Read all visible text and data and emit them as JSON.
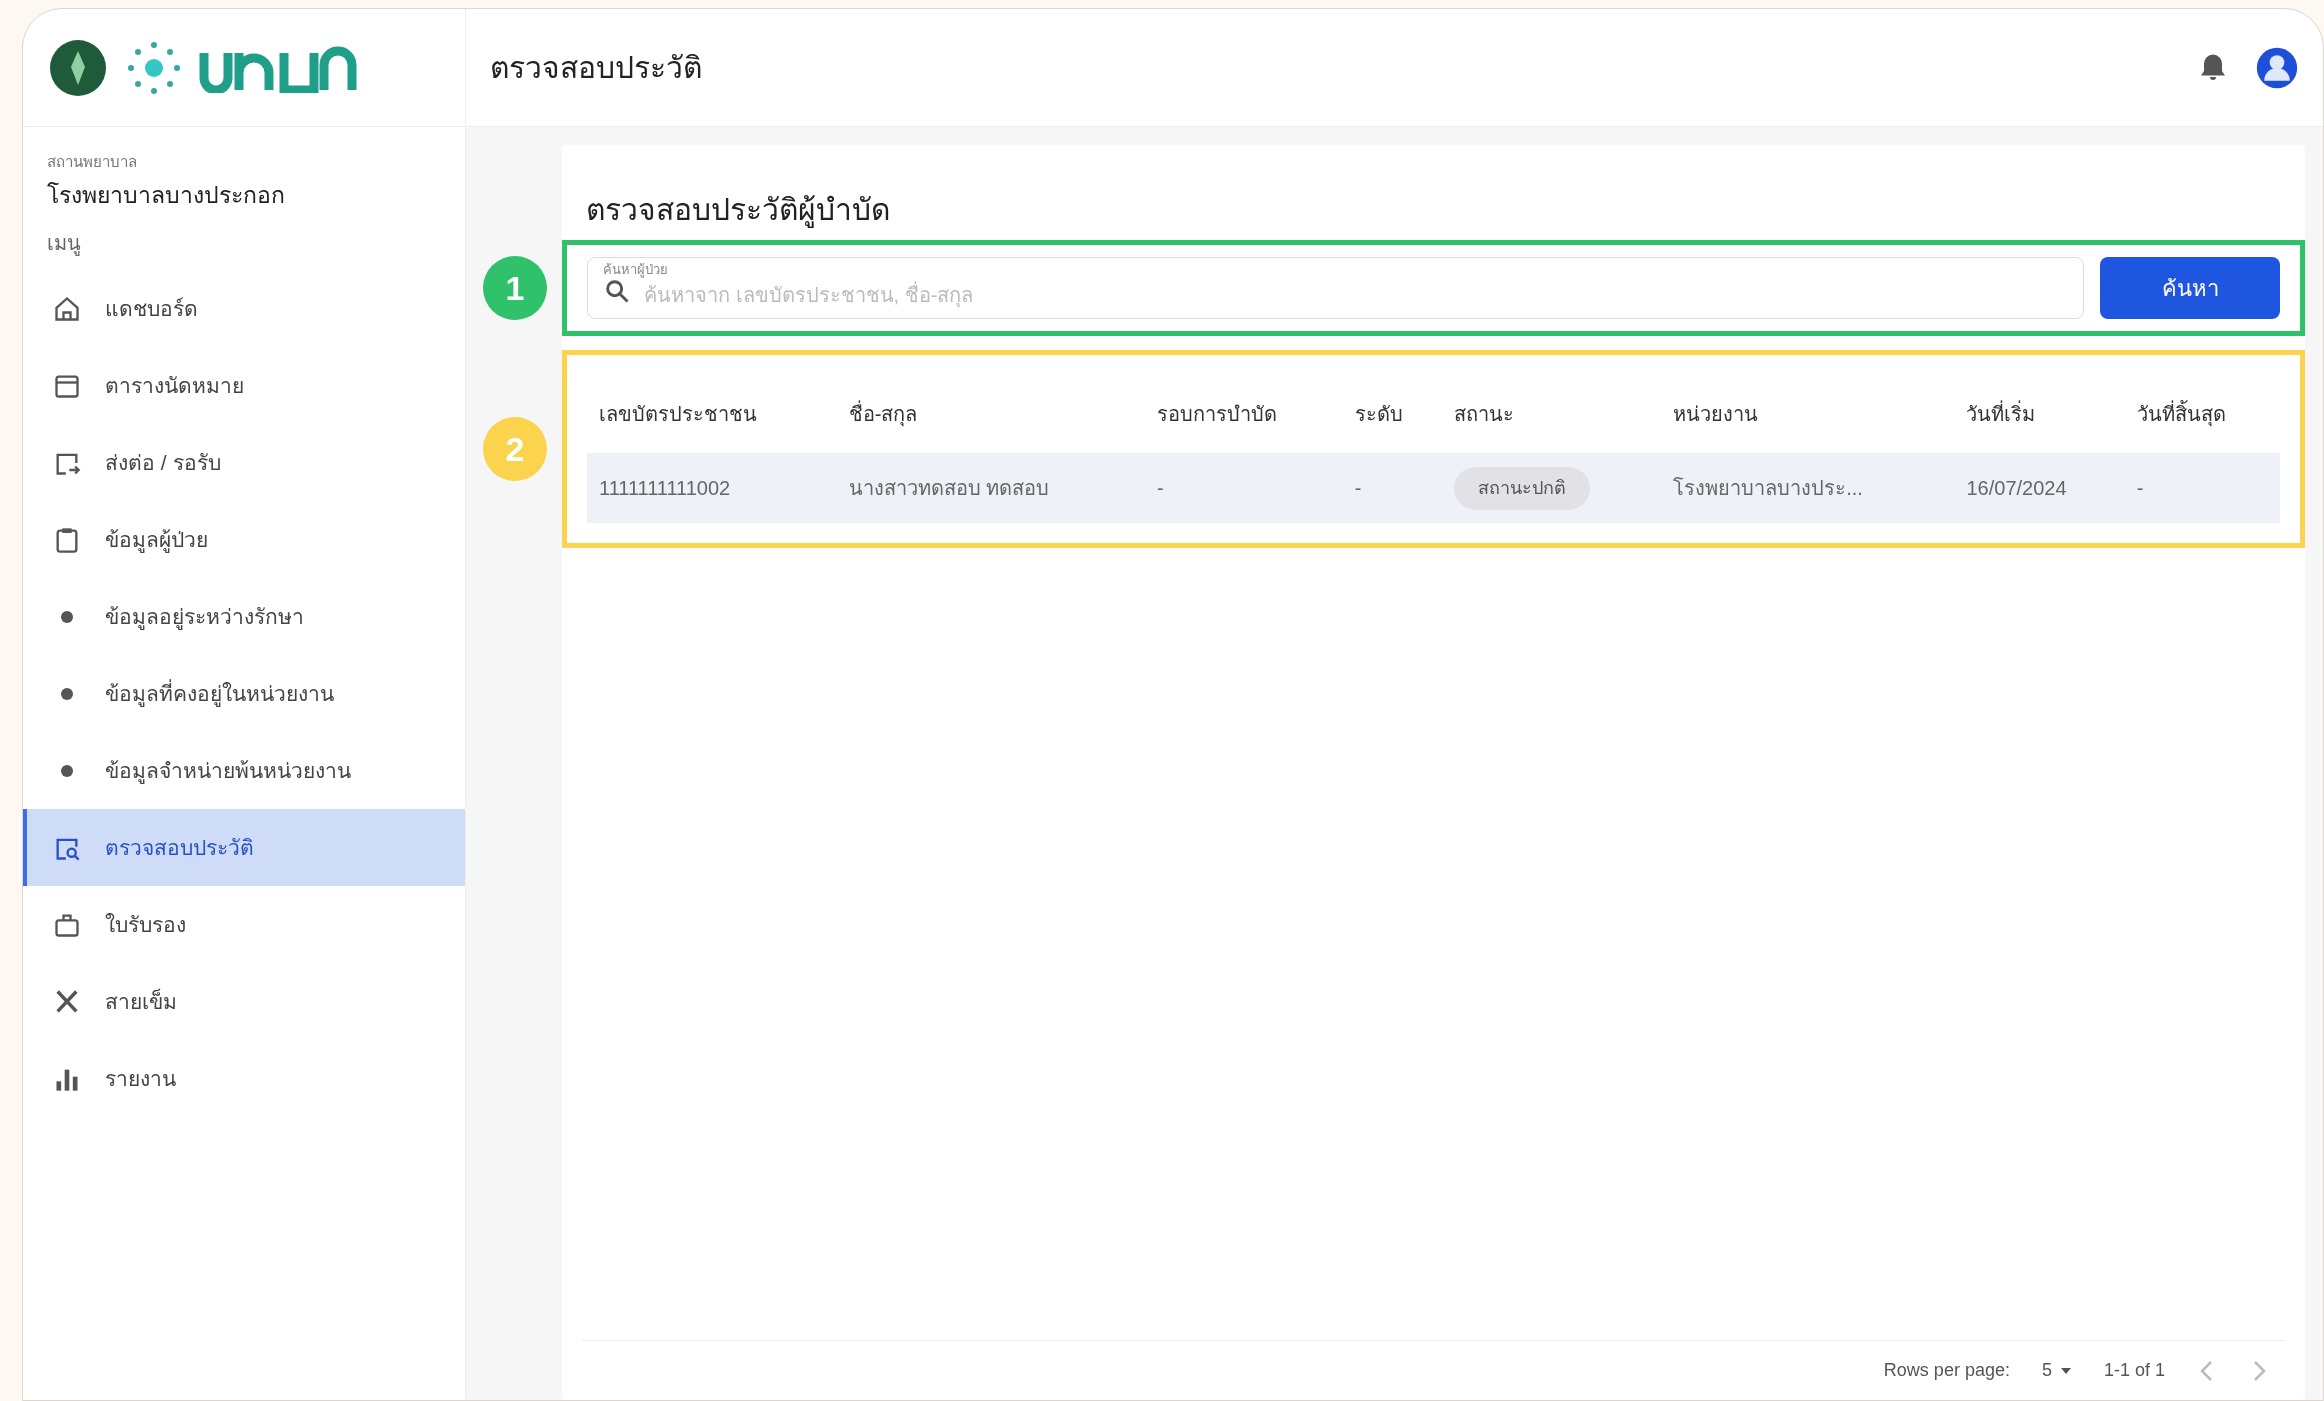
{
  "header": {
    "title": "ตรวจสอบประวัติ"
  },
  "sidebar": {
    "facility_label": "สถานพยาบาล",
    "facility": "โรงพยาบาลบางประกอก",
    "menu_label": "เมนู",
    "items": [
      {
        "label": "แดชบอร์ด",
        "kind": "home",
        "selected": false
      },
      {
        "label": "ตารางนัดหมาย",
        "kind": "calendar",
        "selected": false
      },
      {
        "label": "ส่งต่อ / รอรับ",
        "kind": "transfer",
        "selected": false
      },
      {
        "label": "ข้อมูลผู้ป่วย",
        "kind": "clipboard",
        "selected": false
      },
      {
        "label": "ข้อมูลอยู่ระหว่างรักษา",
        "kind": "dot",
        "selected": false
      },
      {
        "label": "ข้อมูลที่คงอยู่ในหน่วยงาน",
        "kind": "dot",
        "selected": false
      },
      {
        "label": "ข้อมูลจำหน่ายพ้นหน่วยงาน",
        "kind": "dot",
        "selected": false
      },
      {
        "label": "ตรวจสอบประวัติ",
        "kind": "history",
        "selected": true
      },
      {
        "label": "ใบรับรอง",
        "kind": "certificate",
        "selected": false
      },
      {
        "label": "สายเข็ม",
        "kind": "tools",
        "selected": false
      },
      {
        "label": "รายงาน",
        "kind": "chart",
        "selected": false
      }
    ]
  },
  "page": {
    "title": "ตรวจสอบประวัติผู้บำบัด",
    "search": {
      "label": "ค้นหาผู้ป่วย",
      "placeholder": "ค้นหาจาก เลขบัตรประชาชน, ชื่อ-สกุล",
      "button": "ค้นหา"
    },
    "table": {
      "columns": [
        "เลขบัตรประชาชน",
        "ชื่อ-สกุล",
        "รอบการบำบัด",
        "ระดับ",
        "สถานะ",
        "หน่วยงาน",
        "วันที่เริ่ม",
        "วันที่สิ้นสุด"
      ],
      "rows": [
        {
          "cells": [
            "1111111111002",
            "นางสาวทดสอบ ทดสอบ",
            "-",
            "-",
            "สถานะปกติ",
            "โรงพยาบาลบางประ...",
            "16/07/2024",
            "-"
          ]
        }
      ]
    },
    "pagination": {
      "rows_label": "Rows per page:",
      "rows_value": "5",
      "range": "1-1 of 1"
    }
  },
  "annotations": [
    {
      "label": "1",
      "color": "#2fc26b"
    },
    {
      "label": "2",
      "color": "#fcd34d"
    }
  ]
}
